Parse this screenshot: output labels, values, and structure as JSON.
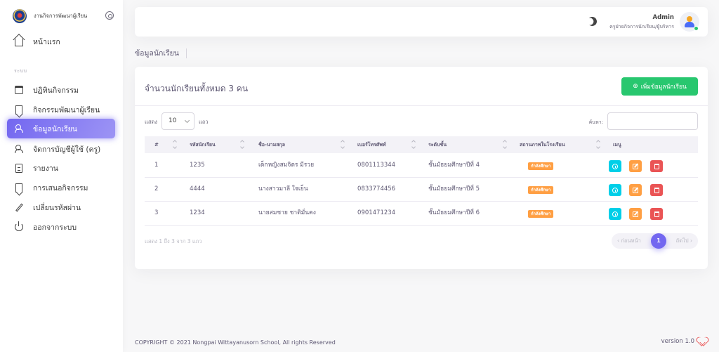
{
  "brand": {
    "name": "งานกิจการพัฒนาผู้เรียน"
  },
  "sidebar": {
    "home_label": "หน้าแรก",
    "section_label": "ระบบ",
    "items": [
      {
        "label": "ปฏิทินกิจกรรม",
        "icon": "calendar-icon"
      },
      {
        "label": "กิจกรรมพัฒนาผู้เรียน",
        "icon": "bookmark-icon"
      },
      {
        "label": "ข้อมูลนักเรียน",
        "icon": "users-icon",
        "active": true
      },
      {
        "label": "จัดการบัญชีผู้ใช้ (ครู)",
        "icon": "users-icon"
      },
      {
        "label": "รายงาน",
        "icon": "file-icon"
      },
      {
        "label": "การเสนอกิจกรรม",
        "icon": "bookmark-icon"
      },
      {
        "label": "เปลี่ยนรหัสผ่าน",
        "icon": "edit-icon"
      },
      {
        "label": "ออกจากระบบ",
        "icon": "power-icon"
      }
    ]
  },
  "header": {
    "user_name": "Admin",
    "user_role": "ครูฝ่ายกิจการนักเรียน/ผู้บริหาร"
  },
  "breadcrumb": "ข้อมูลนักเรียน",
  "card": {
    "title": "จำนวนนักเรียนทั้งหมด 3 คน",
    "add_button": "เพิ่มข้อมูลนักเรียน",
    "show_label": "แสดง",
    "page_size": "10",
    "rows_label": "แถว",
    "search_label": "ค้นหา:"
  },
  "table": {
    "columns": [
      "#",
      "รหัสนักเรียน",
      "ชื่อ-นามสกุล",
      "เบอร์โทรศัพท์",
      "ระดับชั้น",
      "สถานภาพในโรงเรียน",
      "เมนู"
    ],
    "rows": [
      {
        "no": "1",
        "student_id": "1235",
        "name": "เด็กหญิงสมจิตร มีรวย",
        "phone": "0801113344",
        "level": "ชั้นมัธยมศึกษาปีที่ 4",
        "status": "กำลังศึกษา"
      },
      {
        "no": "2",
        "student_id": "4444",
        "name": "นางสาวมาลี ใจเย็น",
        "phone": "0833774456",
        "level": "ชั้นมัธยมศึกษาปีที่ 5",
        "status": "กำลังศึกษา"
      },
      {
        "no": "3",
        "student_id": "1234",
        "name": "นายสมชาย ชาติมั่นคง",
        "phone": "0901471234",
        "level": "ชั้นมัธยมศึกษาปีที่ 6",
        "status": "กำลังศึกษา"
      }
    ]
  },
  "pagination": {
    "info": "แสดง 1 ถึง 3 จาก 3 แถว",
    "prev": "‹ ก่อนหน้า",
    "current": "1",
    "next": "ถัดไป ›"
  },
  "footer": {
    "copyright": "COPYRIGHT © 2021 Nongpai Wittayanusorn School, All rights Reserved",
    "version": "version 1.0"
  },
  "colors": {
    "accent": "#7367f0",
    "success": "#28c76f",
    "warning": "#ff9f43",
    "info": "#00cfe8",
    "danger": "#ea5455"
  }
}
